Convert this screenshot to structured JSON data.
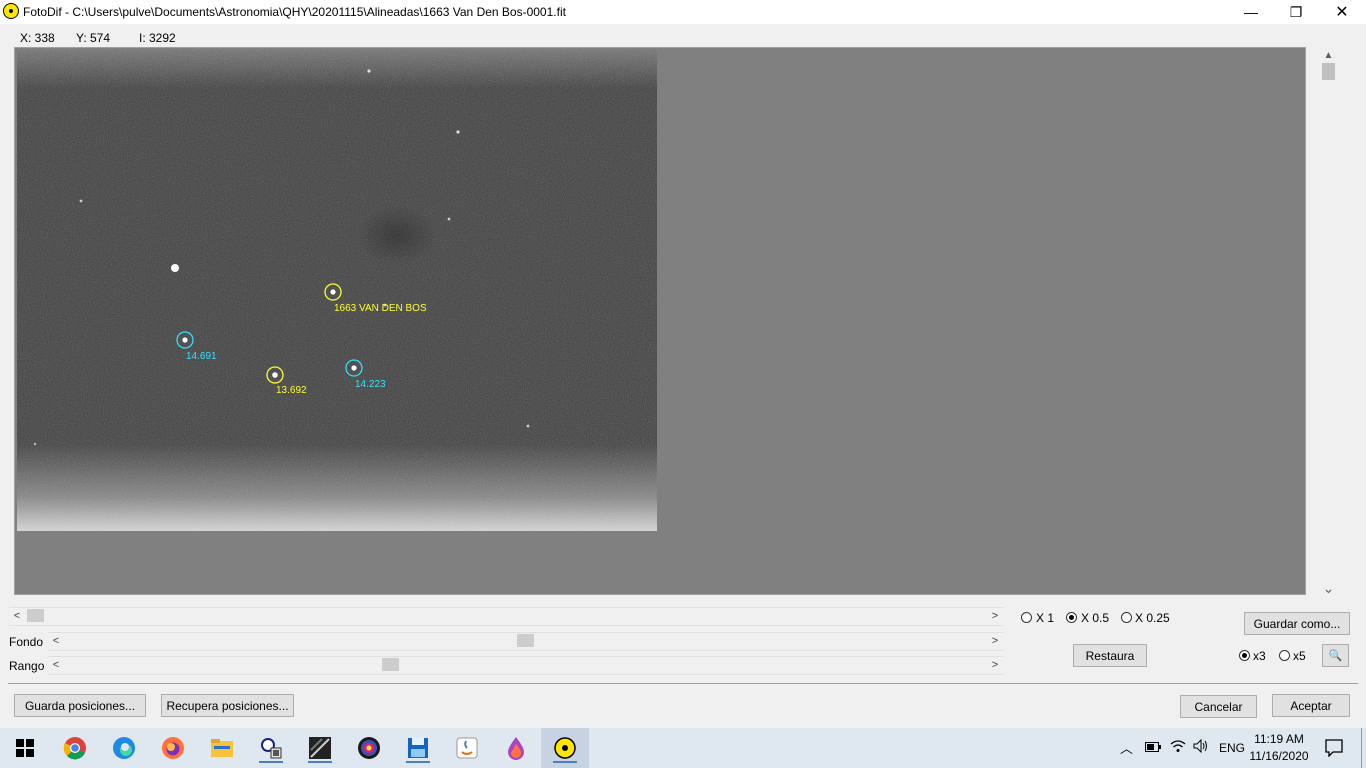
{
  "window": {
    "title": "FotoDif - C:\\Users\\pulve\\Documents\\Astronomia\\QHY\\20201115\\Alineadas\\1663 Van Den Bos-0001.fit",
    "minimize": "—",
    "maximize": "❐",
    "close": "✕"
  },
  "coords": {
    "x": "X: 338",
    "y": "Y: 574",
    "i": "I: 3292"
  },
  "image": {
    "labels": {
      "target": "1663 VAN DEN BOS",
      "ref1": "14.691",
      "ref2": "13.692",
      "ref3": "14.223"
    },
    "colors": {
      "target_marker": "#ffff33",
      "reference_marker": "#33e0ff"
    }
  },
  "scroll": {
    "left_arrow": "<",
    "right_arrow": ">",
    "up_arrow": "▲",
    "down_arrow": "⌄",
    "horizontal_pos": 0.0,
    "fondo_pos": 0.5,
    "rango_pos": 0.35
  },
  "sliders": {
    "fondo_label": "Fondo",
    "rango_label": "Rango"
  },
  "zoom": {
    "options": [
      "X 1",
      "X 0.5",
      "X 0.25"
    ],
    "selected": "X 0.5"
  },
  "magnifier": {
    "options": [
      "x3",
      "x5"
    ],
    "selected": "x3",
    "icon": "🔍"
  },
  "buttons": {
    "guardar_como": "Guardar como...",
    "restaura": "Restaura",
    "guarda_posiciones": "Guarda posiciones...",
    "recupera_posiciones": "Recupera posiciones...",
    "cancelar": "Cancelar",
    "aceptar": "Aceptar"
  },
  "taskbar": {
    "time": "11:19 AM",
    "date": "11/16/2020",
    "language": "ENG",
    "tray_chevron": "︿"
  }
}
